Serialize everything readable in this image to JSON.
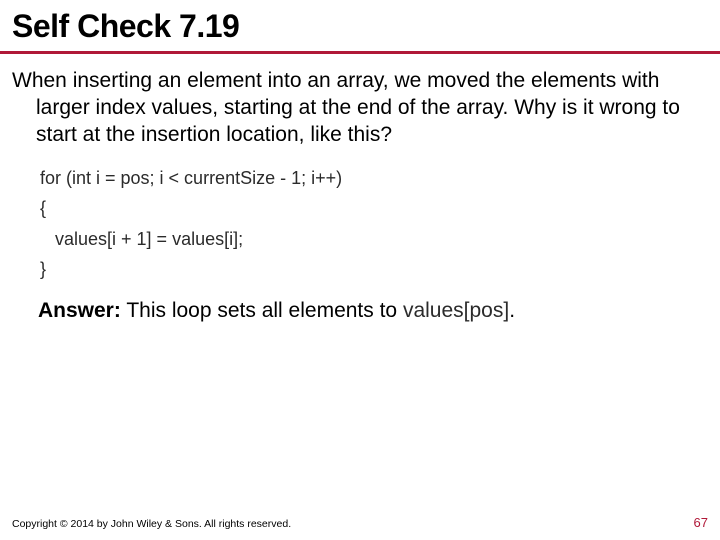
{
  "title": "Self Check 7.19",
  "question": "When inserting an element into an array, we moved the elements with larger index values, starting at the end of the array. Why is it wrong to start at the insertion location, like this?",
  "code": "for (int i = pos; i < currentSize - 1; i++)\n{\n   values[i + 1] = values[i];\n}",
  "answer_label": "Answer:",
  "answer_text": " This loop sets all elements to ",
  "answer_code": "values[pos]",
  "answer_suffix": ".",
  "copyright": "Copyright © 2014 by John Wiley & Sons. All rights reserved.",
  "page_number": "67"
}
